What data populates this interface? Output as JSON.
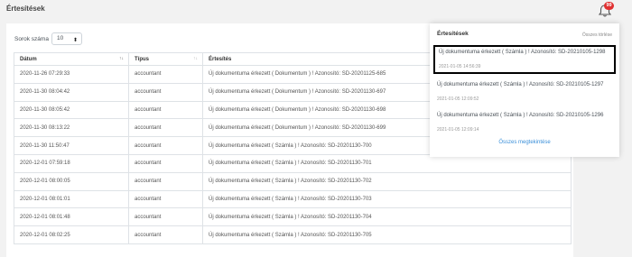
{
  "header": {
    "title": "Értesítések",
    "bell_icon": "bell-icon",
    "badge_count": "99",
    "badge_color": "#e03131"
  },
  "controls": {
    "rows_label": "Sorok száma",
    "rows_value": "10"
  },
  "table": {
    "columns": [
      "Dátum",
      "Típus",
      "Értesítés"
    ],
    "rows": [
      [
        "2020-11-26 07:29:33",
        "accountant",
        "Új dokumentuma érkezett ( Dokumentum ) ! Azonosító: SD-20201125-685"
      ],
      [
        "2020-11-30 08:04:42",
        "accountant",
        "Új dokumentuma érkezett ( Dokumentum ) ! Azonosító: SD-20201130-697"
      ],
      [
        "2020-11-30 08:05:42",
        "accountant",
        "Új dokumentuma érkezett ( Dokumentum ) ! Azonosító: SD-20201130-698"
      ],
      [
        "2020-11-30 08:13:22",
        "accountant",
        "Új dokumentuma érkezett ( Dokumentum ) ! Azonosító: SD-20201130-699"
      ],
      [
        "2020-11-30 11:50:47",
        "accountant",
        "Új dokumentuma érkezett ( Számla ) ! Azonosító: SD-20201130-700"
      ],
      [
        "2020-12-01 07:59:18",
        "accountant",
        "Új dokumentuma érkezett ( Számla ) ! Azonosító: SD-20201130-701"
      ],
      [
        "2020-12-01 08:00:05",
        "accountant",
        "Új dokumentuma érkezett ( Számla ) ! Azonosító: SD-20201130-702"
      ],
      [
        "2020-12-01 08:01:01",
        "accountant",
        "Új dokumentuma érkezett ( Számla ) ! Azonosító: SD-20201130-703"
      ],
      [
        "2020-12-01 08:01:48",
        "accountant",
        "Új dokumentuma érkezett ( Számla ) ! Azonosító: SD-20201130-704"
      ],
      [
        "2020-12-01 08:02:25",
        "accountant",
        "Új dokumentuma érkezett ( Számla ) ! Azonosító: SD-20201130-705"
      ]
    ]
  },
  "notifications": {
    "title": "Értesítések",
    "clear_label": "Összes törlése",
    "view_all_label": "Összes megtekintése",
    "link_color": "#3a8fd9",
    "items": [
      {
        "text": "Új dokumentuma érkezett ( Számla ) ! Azonosító: SD-20210105-1298",
        "time": "2021-01-05 14:56:39"
      },
      {
        "text": "Új dokumentuma érkezett ( Számla ) ! Azonosító: SD-20210105-1297",
        "time": "2021-01-05 12:09:52"
      },
      {
        "text": "Új dokumentuma érkezett ( Számla ) ! Azonosító: SD-20210105-1296",
        "time": "2021-01-05 12:09:14"
      }
    ]
  }
}
